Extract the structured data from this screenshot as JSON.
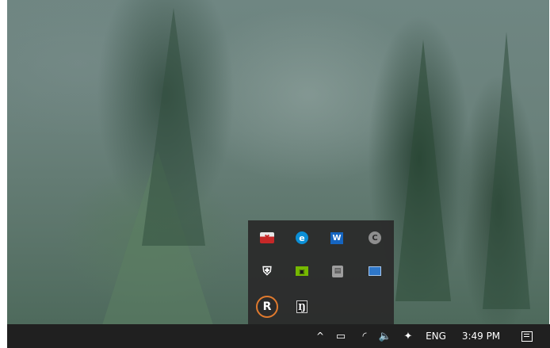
{
  "tray_overflow": {
    "rows": [
      [
        {
          "icon": "antivirus-tray-icon",
          "glyph": "✖"
        },
        {
          "icon": "browser-e-icon",
          "glyph": "e"
        },
        {
          "icon": "waves-audio-icon",
          "glyph": "W"
        },
        {
          "icon": "cc-sync-icon",
          "glyph": "C"
        }
      ],
      [
        {
          "icon": "windows-security-shield-icon",
          "glyph": "⛨"
        },
        {
          "icon": "nvidia-icon",
          "glyph": "▣"
        },
        {
          "icon": "storage-app-icon",
          "glyph": "▤"
        },
        {
          "icon": "monitor-icon",
          "glyph": ""
        }
      ],
      [
        {
          "icon": "r-app-icon",
          "glyph": "R"
        },
        {
          "icon": "hy-app-icon",
          "glyph": "Ŋ"
        }
      ]
    ]
  },
  "taskbar": {
    "chevron_glyph": "^",
    "power_glyph": "▭",
    "wifi_glyph": "◜",
    "volume_glyph": "🔈",
    "dropbox_glyph": "✦",
    "language": "ENG",
    "time": "3:49 PM"
  },
  "colors": {
    "taskbar": "#202020",
    "flyout": "#2b2b2b",
    "highlight_ring": "#e07a2e"
  }
}
